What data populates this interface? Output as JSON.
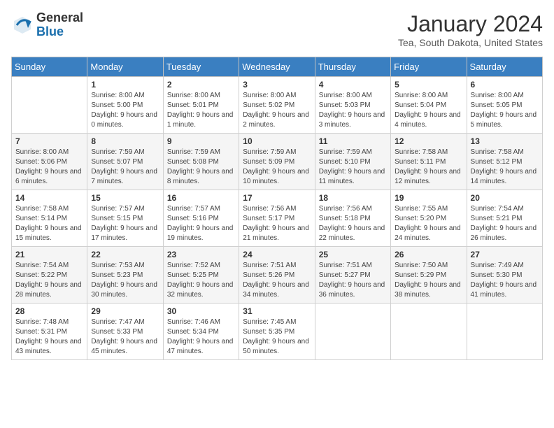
{
  "logo": {
    "general": "General",
    "blue": "Blue"
  },
  "title": "January 2024",
  "location": "Tea, South Dakota, United States",
  "headers": [
    "Sunday",
    "Monday",
    "Tuesday",
    "Wednesday",
    "Thursday",
    "Friday",
    "Saturday"
  ],
  "weeks": [
    [
      {
        "day": "",
        "sunrise": "",
        "sunset": "",
        "daylight": ""
      },
      {
        "day": "1",
        "sunrise": "Sunrise: 8:00 AM",
        "sunset": "Sunset: 5:00 PM",
        "daylight": "Daylight: 9 hours and 0 minutes."
      },
      {
        "day": "2",
        "sunrise": "Sunrise: 8:00 AM",
        "sunset": "Sunset: 5:01 PM",
        "daylight": "Daylight: 9 hours and 1 minute."
      },
      {
        "day": "3",
        "sunrise": "Sunrise: 8:00 AM",
        "sunset": "Sunset: 5:02 PM",
        "daylight": "Daylight: 9 hours and 2 minutes."
      },
      {
        "day": "4",
        "sunrise": "Sunrise: 8:00 AM",
        "sunset": "Sunset: 5:03 PM",
        "daylight": "Daylight: 9 hours and 3 minutes."
      },
      {
        "day": "5",
        "sunrise": "Sunrise: 8:00 AM",
        "sunset": "Sunset: 5:04 PM",
        "daylight": "Daylight: 9 hours and 4 minutes."
      },
      {
        "day": "6",
        "sunrise": "Sunrise: 8:00 AM",
        "sunset": "Sunset: 5:05 PM",
        "daylight": "Daylight: 9 hours and 5 minutes."
      }
    ],
    [
      {
        "day": "7",
        "sunrise": "Sunrise: 8:00 AM",
        "sunset": "Sunset: 5:06 PM",
        "daylight": "Daylight: 9 hours and 6 minutes."
      },
      {
        "day": "8",
        "sunrise": "Sunrise: 7:59 AM",
        "sunset": "Sunset: 5:07 PM",
        "daylight": "Daylight: 9 hours and 7 minutes."
      },
      {
        "day": "9",
        "sunrise": "Sunrise: 7:59 AM",
        "sunset": "Sunset: 5:08 PM",
        "daylight": "Daylight: 9 hours and 8 minutes."
      },
      {
        "day": "10",
        "sunrise": "Sunrise: 7:59 AM",
        "sunset": "Sunset: 5:09 PM",
        "daylight": "Daylight: 9 hours and 10 minutes."
      },
      {
        "day": "11",
        "sunrise": "Sunrise: 7:59 AM",
        "sunset": "Sunset: 5:10 PM",
        "daylight": "Daylight: 9 hours and 11 minutes."
      },
      {
        "day": "12",
        "sunrise": "Sunrise: 7:58 AM",
        "sunset": "Sunset: 5:11 PM",
        "daylight": "Daylight: 9 hours and 12 minutes."
      },
      {
        "day": "13",
        "sunrise": "Sunrise: 7:58 AM",
        "sunset": "Sunset: 5:12 PM",
        "daylight": "Daylight: 9 hours and 14 minutes."
      }
    ],
    [
      {
        "day": "14",
        "sunrise": "Sunrise: 7:58 AM",
        "sunset": "Sunset: 5:14 PM",
        "daylight": "Daylight: 9 hours and 15 minutes."
      },
      {
        "day": "15",
        "sunrise": "Sunrise: 7:57 AM",
        "sunset": "Sunset: 5:15 PM",
        "daylight": "Daylight: 9 hours and 17 minutes."
      },
      {
        "day": "16",
        "sunrise": "Sunrise: 7:57 AM",
        "sunset": "Sunset: 5:16 PM",
        "daylight": "Daylight: 9 hours and 19 minutes."
      },
      {
        "day": "17",
        "sunrise": "Sunrise: 7:56 AM",
        "sunset": "Sunset: 5:17 PM",
        "daylight": "Daylight: 9 hours and 21 minutes."
      },
      {
        "day": "18",
        "sunrise": "Sunrise: 7:56 AM",
        "sunset": "Sunset: 5:18 PM",
        "daylight": "Daylight: 9 hours and 22 minutes."
      },
      {
        "day": "19",
        "sunrise": "Sunrise: 7:55 AM",
        "sunset": "Sunset: 5:20 PM",
        "daylight": "Daylight: 9 hours and 24 minutes."
      },
      {
        "day": "20",
        "sunrise": "Sunrise: 7:54 AM",
        "sunset": "Sunset: 5:21 PM",
        "daylight": "Daylight: 9 hours and 26 minutes."
      }
    ],
    [
      {
        "day": "21",
        "sunrise": "Sunrise: 7:54 AM",
        "sunset": "Sunset: 5:22 PM",
        "daylight": "Daylight: 9 hours and 28 minutes."
      },
      {
        "day": "22",
        "sunrise": "Sunrise: 7:53 AM",
        "sunset": "Sunset: 5:23 PM",
        "daylight": "Daylight: 9 hours and 30 minutes."
      },
      {
        "day": "23",
        "sunrise": "Sunrise: 7:52 AM",
        "sunset": "Sunset: 5:25 PM",
        "daylight": "Daylight: 9 hours and 32 minutes."
      },
      {
        "day": "24",
        "sunrise": "Sunrise: 7:51 AM",
        "sunset": "Sunset: 5:26 PM",
        "daylight": "Daylight: 9 hours and 34 minutes."
      },
      {
        "day": "25",
        "sunrise": "Sunrise: 7:51 AM",
        "sunset": "Sunset: 5:27 PM",
        "daylight": "Daylight: 9 hours and 36 minutes."
      },
      {
        "day": "26",
        "sunrise": "Sunrise: 7:50 AM",
        "sunset": "Sunset: 5:29 PM",
        "daylight": "Daylight: 9 hours and 38 minutes."
      },
      {
        "day": "27",
        "sunrise": "Sunrise: 7:49 AM",
        "sunset": "Sunset: 5:30 PM",
        "daylight": "Daylight: 9 hours and 41 minutes."
      }
    ],
    [
      {
        "day": "28",
        "sunrise": "Sunrise: 7:48 AM",
        "sunset": "Sunset: 5:31 PM",
        "daylight": "Daylight: 9 hours and 43 minutes."
      },
      {
        "day": "29",
        "sunrise": "Sunrise: 7:47 AM",
        "sunset": "Sunset: 5:33 PM",
        "daylight": "Daylight: 9 hours and 45 minutes."
      },
      {
        "day": "30",
        "sunrise": "Sunrise: 7:46 AM",
        "sunset": "Sunset: 5:34 PM",
        "daylight": "Daylight: 9 hours and 47 minutes."
      },
      {
        "day": "31",
        "sunrise": "Sunrise: 7:45 AM",
        "sunset": "Sunset: 5:35 PM",
        "daylight": "Daylight: 9 hours and 50 minutes."
      },
      {
        "day": "",
        "sunrise": "",
        "sunset": "",
        "daylight": ""
      },
      {
        "day": "",
        "sunrise": "",
        "sunset": "",
        "daylight": ""
      },
      {
        "day": "",
        "sunrise": "",
        "sunset": "",
        "daylight": ""
      }
    ]
  ]
}
